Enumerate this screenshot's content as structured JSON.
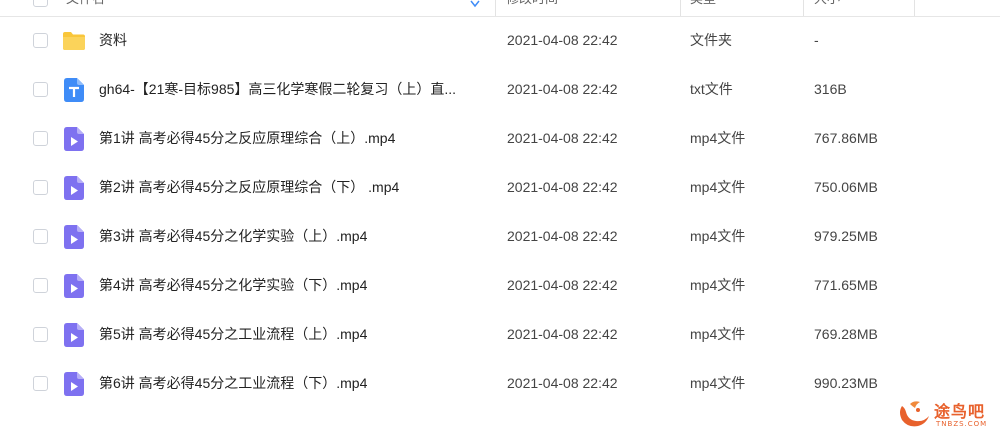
{
  "header": {
    "col_name": "文件名",
    "col_time": "修改时间",
    "col_type": "类型",
    "col_size": "大小"
  },
  "files": [
    {
      "name": "资料",
      "time": "2021-04-08 22:42",
      "type": "文件夹",
      "size": "-",
      "icon": "folder-icon"
    },
    {
      "name": "gh64-【21寒-目标985】高三化学寒假二轮复习（上）直...",
      "time": "2021-04-08 22:42",
      "type": "txt文件",
      "size": "316B",
      "icon": "txt-file-icon"
    },
    {
      "name": "第1讲 高考必得45分之反应原理综合（上）.mp4",
      "time": "2021-04-08 22:42",
      "type": "mp4文件",
      "size": "767.86MB",
      "icon": "video-file-icon"
    },
    {
      "name": "第2讲 高考必得45分之反应原理综合（下） .mp4",
      "time": "2021-04-08 22:42",
      "type": "mp4文件",
      "size": "750.06MB",
      "icon": "video-file-icon"
    },
    {
      "name": "第3讲 高考必得45分之化学实验（上）.mp4",
      "time": "2021-04-08 22:42",
      "type": "mp4文件",
      "size": "979.25MB",
      "icon": "video-file-icon"
    },
    {
      "name": "第4讲 高考必得45分之化学实验（下）.mp4",
      "time": "2021-04-08 22:42",
      "type": "mp4文件",
      "size": "771.65MB",
      "icon": "video-file-icon"
    },
    {
      "name": "第5讲 高考必得45分之工业流程（上）.mp4",
      "time": "2021-04-08 22:42",
      "type": "mp4文件",
      "size": "769.28MB",
      "icon": "video-file-icon"
    },
    {
      "name": "第6讲 高考必得45分之工业流程（下）.mp4",
      "time": "2021-04-08 22:42",
      "type": "mp4文件",
      "size": "990.23MB",
      "icon": "video-file-icon"
    }
  ],
  "watermark": {
    "logo_text": "途鸟吧",
    "logo_sub": "TNBZS.COM"
  },
  "colors": {
    "folder": "#f9c63a",
    "txt": "#3f8cf7",
    "video": "#7e71f0"
  }
}
